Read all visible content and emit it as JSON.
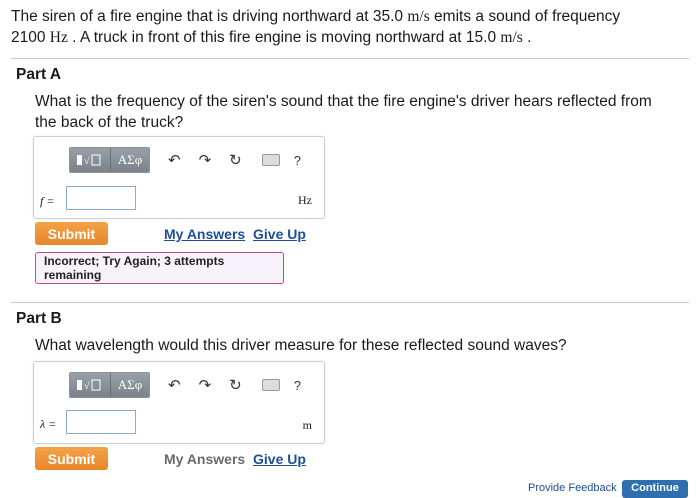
{
  "problem": {
    "line1_pre": "The siren of a fire engine that is driving northward at 35.0 ",
    "speed1_unit": "m/s",
    "line1_post": " emits a sound of frequency",
    "line2_freq": "2100 ",
    "freq_unit": "Hz",
    "line2_mid": " . A truck in front of this fire engine is moving northward at 15.0 ",
    "speed2_unit": "m/s",
    "line2_end": " ."
  },
  "part_a": {
    "title": "Part A",
    "question": "What is the frequency of the siren's sound that the fire engine's driver hears reflected from the back of the truck?",
    "toolbar": {
      "greek": "ΑΣφ",
      "help": "?"
    },
    "variable": "f =",
    "input_value": "",
    "unit": "Hz",
    "submit_label": "Submit",
    "my_answers": "My Answers",
    "give_up": "Give Up",
    "feedback": "Incorrect; Try Again; 3 attempts remaining"
  },
  "part_b": {
    "title": "Part B",
    "question": "What wavelength would this driver measure for these reflected sound waves?",
    "toolbar": {
      "greek": "ΑΣφ",
      "help": "?"
    },
    "variable": "λ =",
    "input_value": "",
    "unit": "m",
    "submit_label": "Submit",
    "my_answers": "My Answers",
    "give_up": "Give Up"
  },
  "footer": {
    "provide_feedback": "Provide Feedback",
    "continue": "Continue"
  },
  "colors": {
    "submit": "#e9862a",
    "link": "#1d4e98",
    "feedback_border": "#b6508a",
    "continue": "#2f6fb0"
  }
}
